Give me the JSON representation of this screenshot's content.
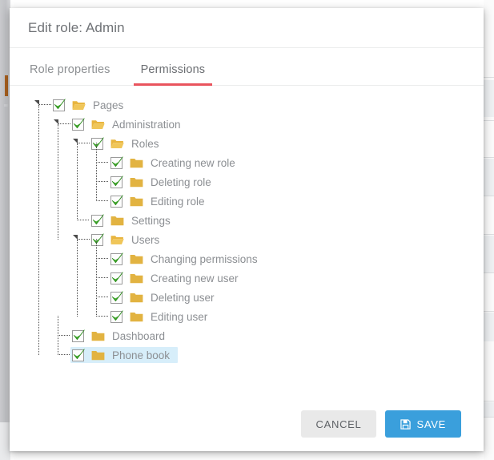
{
  "background": {
    "left_rail": "gray-sidebar-rail",
    "orange_marker": "#a9601f",
    "row_lines": [
      96,
      150,
      196,
      244,
      292,
      340,
      388,
      500,
      520
    ]
  },
  "modal": {
    "title": "Edit role: Admin",
    "accent_color": "#e9545d",
    "tabs": [
      {
        "label": "Role properties",
        "active": false
      },
      {
        "label": "Permissions",
        "active": true
      }
    ],
    "tree": {
      "checkbox_color": "#3faa29",
      "folder_color": "#e3b23c",
      "selected_highlight": "#d7eefa",
      "nodes": [
        {
          "label": "Pages",
          "depth": 0,
          "type": "open",
          "checked": true,
          "expander": true,
          "selected": false
        },
        {
          "label": "Administration",
          "depth": 1,
          "type": "open",
          "checked": true,
          "expander": true,
          "selected": false
        },
        {
          "label": "Roles",
          "depth": 2,
          "type": "open",
          "checked": true,
          "expander": true,
          "selected": false
        },
        {
          "label": "Creating new role",
          "depth": 3,
          "type": "closed",
          "checked": true,
          "expander": false,
          "selected": false
        },
        {
          "label": "Deleting role",
          "depth": 3,
          "type": "closed",
          "checked": true,
          "expander": false,
          "selected": false
        },
        {
          "label": "Editing role",
          "depth": 3,
          "type": "closed",
          "checked": true,
          "expander": false,
          "selected": false
        },
        {
          "label": "Settings",
          "depth": 2,
          "type": "closed",
          "checked": true,
          "expander": false,
          "selected": false
        },
        {
          "label": "Users",
          "depth": 2,
          "type": "open",
          "checked": true,
          "expander": true,
          "selected": false
        },
        {
          "label": "Changing permissions",
          "depth": 3,
          "type": "closed",
          "checked": true,
          "expander": false,
          "selected": false
        },
        {
          "label": "Creating new user",
          "depth": 3,
          "type": "closed",
          "checked": true,
          "expander": false,
          "selected": false
        },
        {
          "label": "Deleting user",
          "depth": 3,
          "type": "closed",
          "checked": true,
          "expander": false,
          "selected": false
        },
        {
          "label": "Editing user",
          "depth": 3,
          "type": "closed",
          "checked": true,
          "expander": false,
          "selected": false
        },
        {
          "label": "Dashboard",
          "depth": 1,
          "type": "closed",
          "checked": true,
          "expander": false,
          "selected": false
        },
        {
          "label": "Phone book",
          "depth": 1,
          "type": "closed",
          "checked": true,
          "expander": false,
          "selected": true
        }
      ]
    },
    "footer": {
      "cancel_label": "CANCEL",
      "save_label": "SAVE",
      "save_icon": "floppy-disk-icon",
      "save_color": "#3a9fdc"
    }
  }
}
